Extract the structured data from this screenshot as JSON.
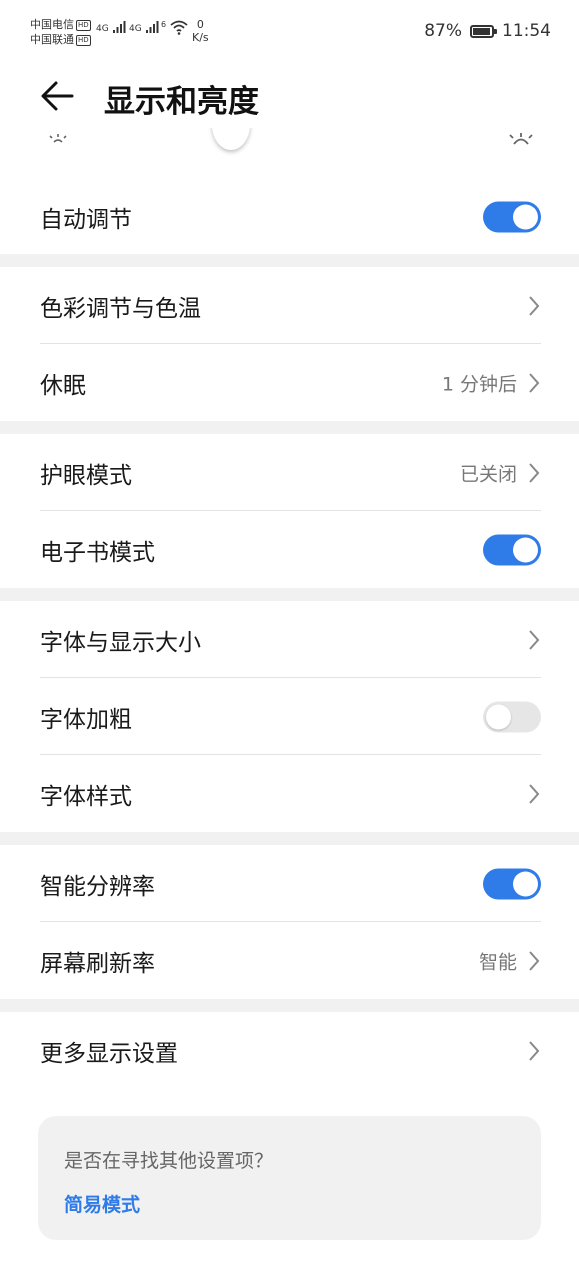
{
  "status_bar": {
    "carrier1": "中国电信",
    "carrier2": "中国联通",
    "hd_badge": "HD",
    "signal1": "4G",
    "signal2": "4G",
    "wifi": "6",
    "net_speed_value": "0",
    "net_speed_unit": "K/s",
    "battery": "87%",
    "battery_level": 0.87,
    "time": "11:54"
  },
  "header": {
    "title": "显示和亮度"
  },
  "brightness": {
    "icon_low": "sun-low-icon",
    "icon_high": "sun-high-icon"
  },
  "settings": {
    "auto_adjust": {
      "label": "自动调节",
      "enabled": true
    },
    "color_temp": {
      "label": "色彩调节与色温"
    },
    "sleep": {
      "label": "休眠",
      "value": "1 分钟后"
    },
    "eye_comfort": {
      "label": "护眼模式",
      "value": "已关闭"
    },
    "ebook_mode": {
      "label": "电子书模式",
      "enabled": true
    },
    "font_size": {
      "label": "字体与显示大小"
    },
    "bold_text": {
      "label": "字体加粗",
      "enabled": false
    },
    "font_style": {
      "label": "字体样式"
    },
    "smart_resolution": {
      "label": "智能分辨率",
      "enabled": true
    },
    "refresh_rate": {
      "label": "屏幕刷新率",
      "value": "智能"
    },
    "more_display": {
      "label": "更多显示设置"
    }
  },
  "suggestion": {
    "question": "是否在寻找其他设置项？",
    "link": "简易模式"
  },
  "colors": {
    "accent": "#2f7ce8",
    "toggle_off": "#e6e6e6",
    "section_gap": "#f1f1f1"
  }
}
